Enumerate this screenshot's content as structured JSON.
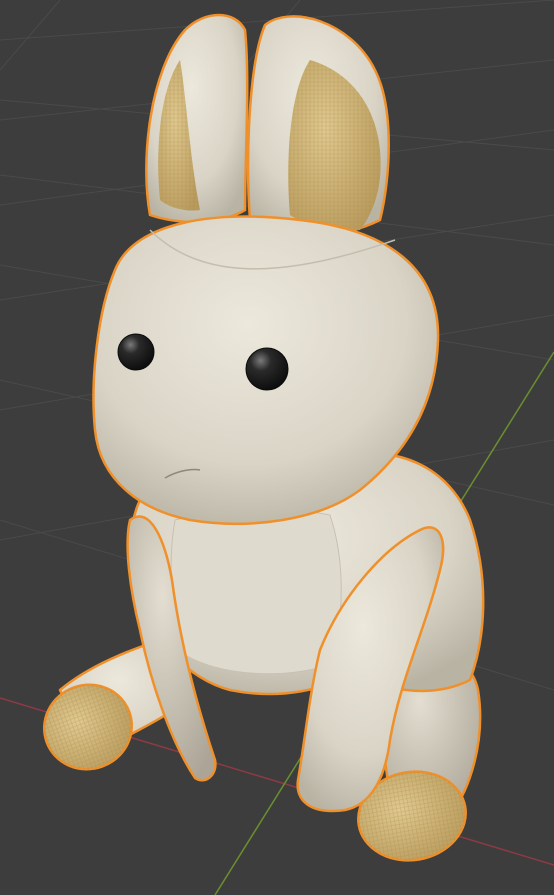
{
  "viewport": {
    "background_color": "#3d3d3d",
    "grid_color": "#4a4a4a",
    "x_axis_color": "#8c3a45",
    "y_axis_color": "#6a8f2e",
    "selection_outline_color": "#f0902a"
  },
  "object": {
    "icon": "stuffed-bunny-model",
    "selected": true,
    "fabric_color": "#d9d4c6",
    "burlap_color": "#cdb276",
    "eye_color": "#1e1e1e"
  }
}
